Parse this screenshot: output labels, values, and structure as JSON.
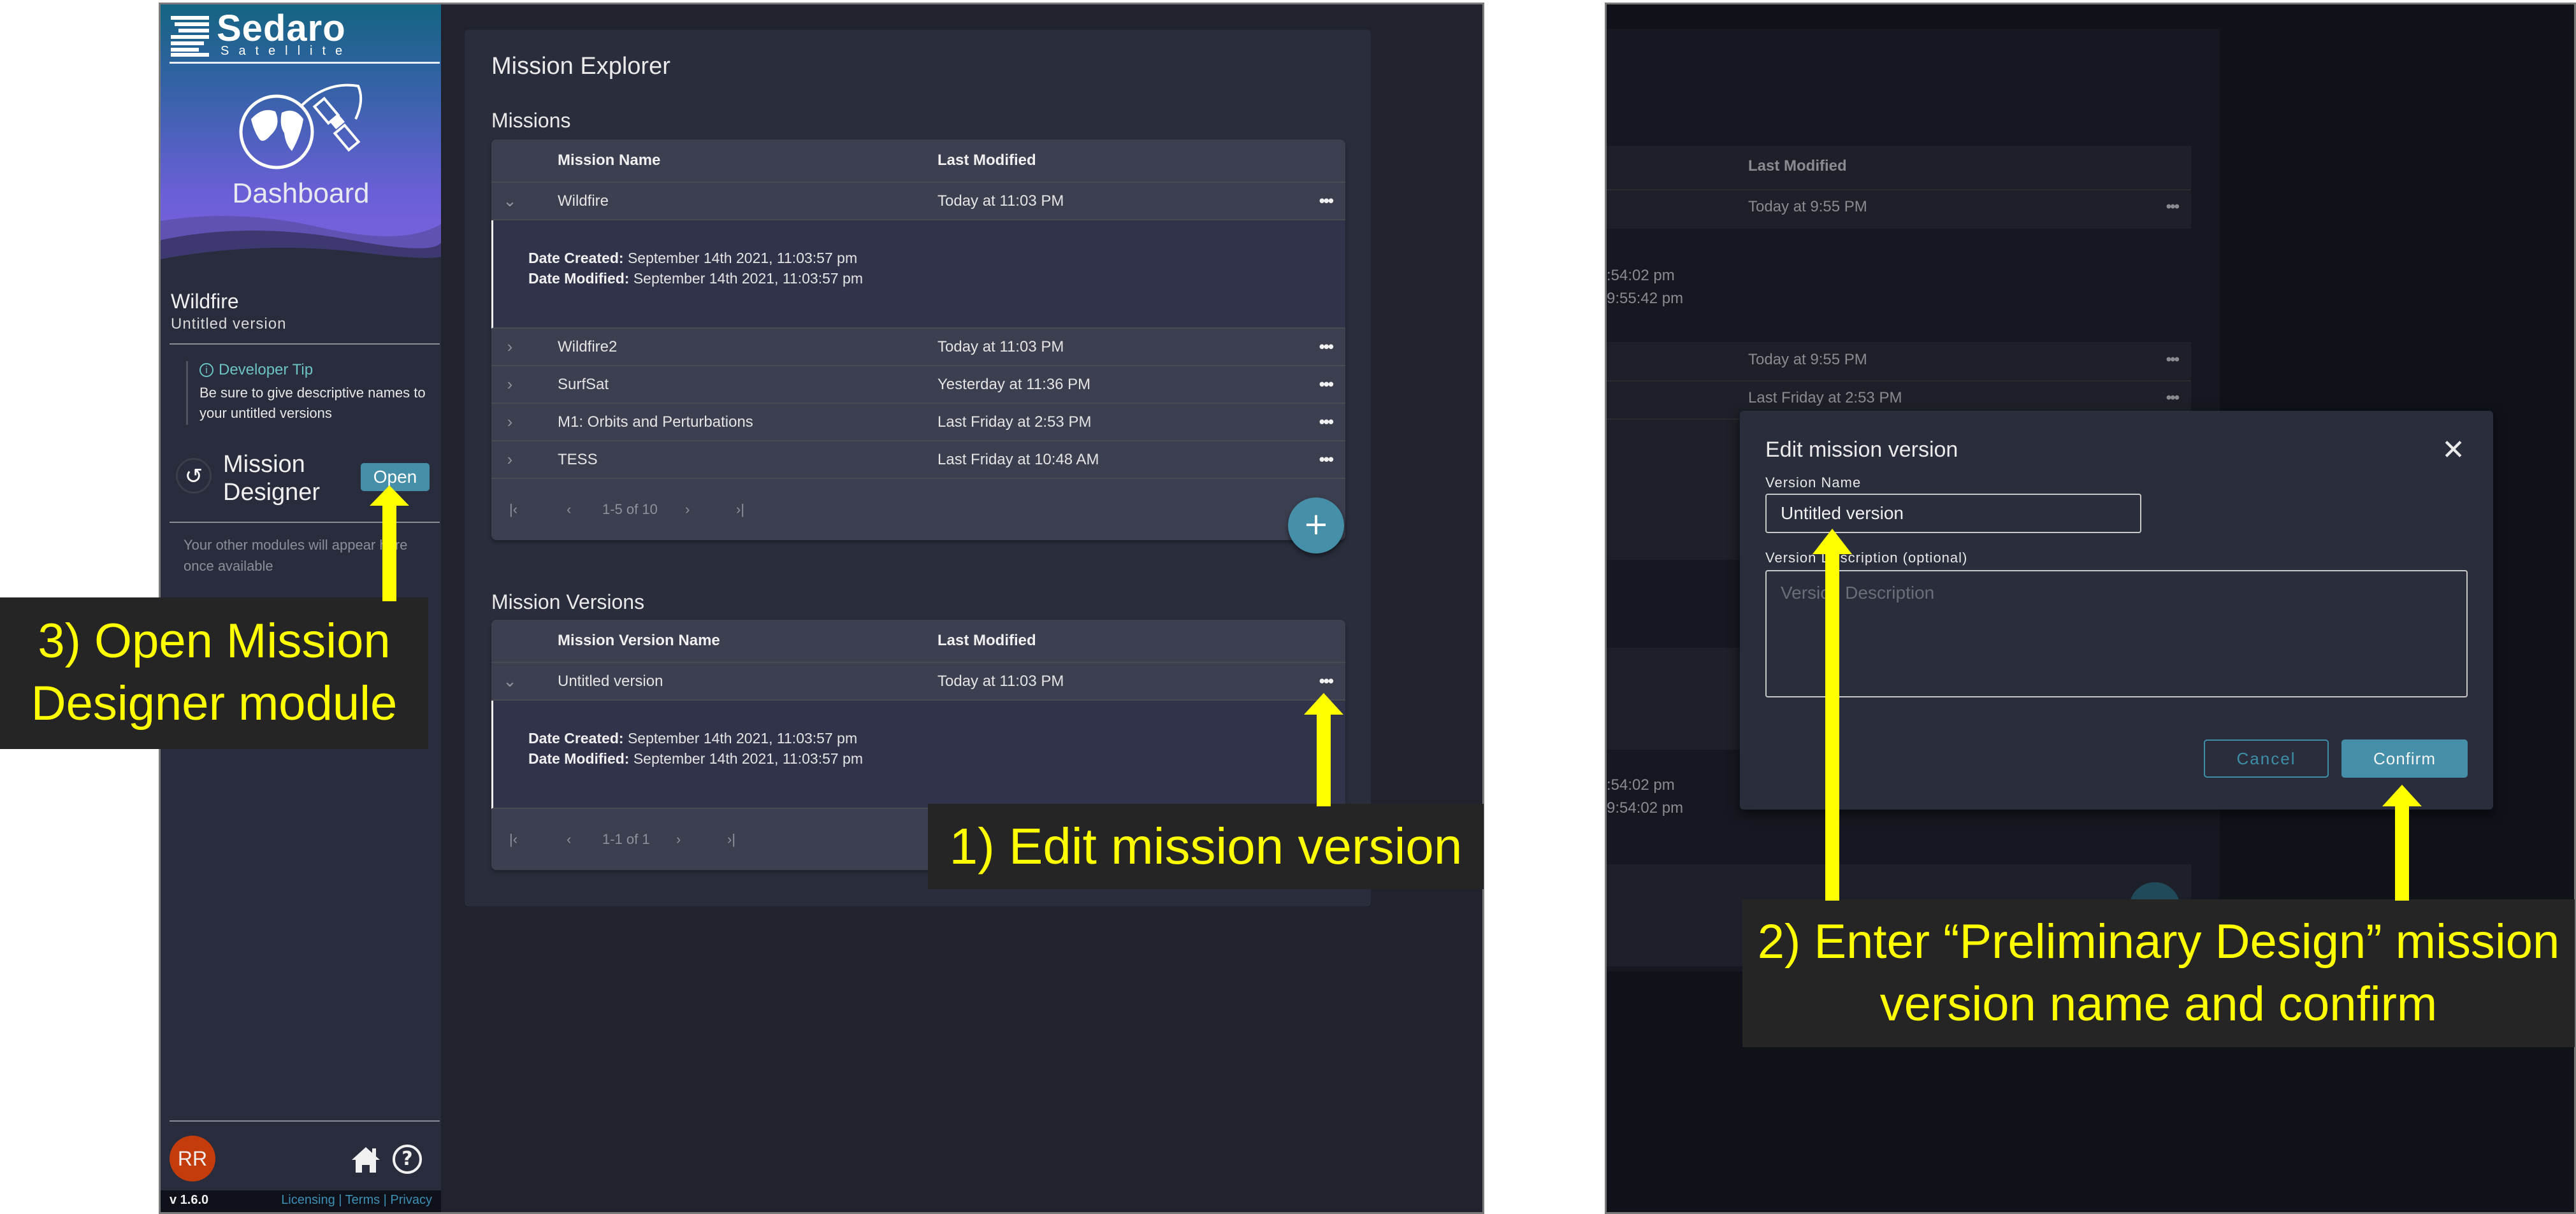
{
  "left_screenshot": {
    "sidebar": {
      "brand": "Sedaro",
      "brand_sub": "Satellite",
      "section_title": "Dashboard",
      "project_name": "Wildfire",
      "project_version": "Untitled version",
      "tip_title": "Developer Tip",
      "tip_body": "Be sure to give descriptive names to your untitled versions",
      "module_name_line1": "Mission",
      "module_name_line2": "Designer",
      "module_open_label": "Open",
      "other_modules_note": "Your other modules will appear here once available",
      "avatar_initials": "RR",
      "avatar_color": "#c43c0c",
      "home_icon": "home-icon",
      "help_icon": "help-circle-icon",
      "version": "v 1.6.0",
      "footer_links": [
        "Licensing",
        "Terms",
        "Privacy"
      ]
    },
    "main": {
      "title": "Mission Explorer",
      "missions": {
        "heading": "Missions",
        "columns": [
          "Mission Name",
          "Last Modified"
        ],
        "rows": [
          {
            "name": "Wildfire",
            "modified": "Today at 11:03 PM",
            "expanded": true,
            "date_created_label": "Date Created:",
            "date_created": "September 14th 2021, 11:03:57 pm",
            "date_modified_label": "Date Modified:",
            "date_modified": "September 14th 2021, 11:03:57 pm"
          },
          {
            "name": "Wildfire2",
            "modified": "Today at 11:03 PM"
          },
          {
            "name": "SurfSat",
            "modified": "Yesterday at 11:36 PM"
          },
          {
            "name": "M1: Orbits and Perturbations",
            "modified": "Last Friday at 2:53 PM"
          },
          {
            "name": "TESS",
            "modified": "Last Friday at 10:48 AM"
          }
        ],
        "pagination": "1-5 of 10",
        "add_button": "+"
      },
      "versions": {
        "heading": "Mission Versions",
        "columns": [
          "Mission Version Name",
          "Last Modified"
        ],
        "rows": [
          {
            "name": "Untitled version",
            "modified": "Today at 11:03 PM",
            "expanded": true,
            "date_created_label": "Date Created:",
            "date_created": "September 14th 2021, 11:03:57 pm",
            "date_modified_label": "Date Modified:",
            "date_modified": "September 14th 2021, 11:03:57 pm"
          }
        ],
        "pagination": "1-1 of 1"
      }
    }
  },
  "right_screenshot": {
    "background": {
      "column_header": "Last Modified",
      "rows": [
        "Today at 9:55 PM",
        "Today at 9:55 PM",
        "Last Friday at 2:53 PM"
      ],
      "detail_lines_top": [
        ":54:02 pm",
        "9:55:42 pm"
      ],
      "detail_lines_bottom": [
        ":54:02 pm",
        "9:54:02 pm"
      ]
    },
    "dialog": {
      "title": "Edit mission version",
      "name_label": "Version Name",
      "name_value": "Untitled version",
      "desc_label": "Version Description (optional)",
      "desc_placeholder": "Version Description",
      "cancel_label": "Cancel",
      "confirm_label": "Confirm"
    }
  },
  "annotations": {
    "step1": "1) Edit mission version",
    "step2_line1": "2) Enter “Preliminary Design” mission",
    "step2_line2": "version name and confirm",
    "step3_line1": "3) Open Mission",
    "step3_line2": "Designer module",
    "color": "#ffff00"
  }
}
